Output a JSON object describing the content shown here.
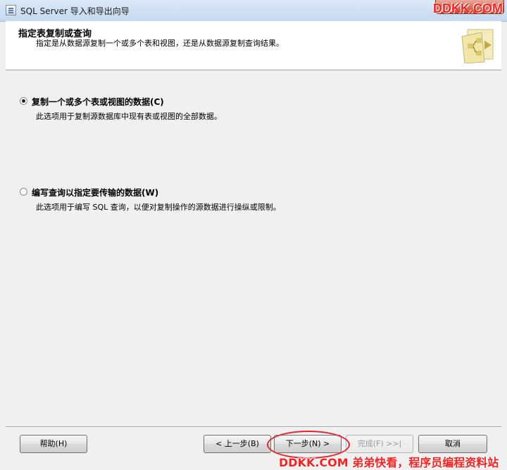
{
  "window": {
    "title": "SQL Server 导入和导出向导"
  },
  "watermarks": {
    "top": "DDKK.COM",
    "bottom": "DDKK.COM 弟弟快看，程序员编程资料站"
  },
  "header": {
    "title": "指定表复制或查询",
    "description": "指定是从数据源复制一个或多个表和视图，还是从数据源复制查询结果。",
    "icon": "wizard-table-icon"
  },
  "options": [
    {
      "label": "复制一个或多个表或视图的数据(C)",
      "description": "此选项用于复制源数据库中现有表或视图的全部数据。",
      "selected": true
    },
    {
      "label": "编写查询以指定要传输的数据(W)",
      "description": "此选项用于编写 SQL 查询，以便对复制操作的源数据进行操纵或限制。",
      "selected": false
    }
  ],
  "buttons": {
    "help": "帮助(H)",
    "back": "< 上一步(B)",
    "next": "下一步(N) >",
    "finish": "完成(F) >>|",
    "cancel": "取消"
  },
  "colors": {
    "annotation_circle": "#e8232f",
    "watermark": "#ff1e1e"
  }
}
